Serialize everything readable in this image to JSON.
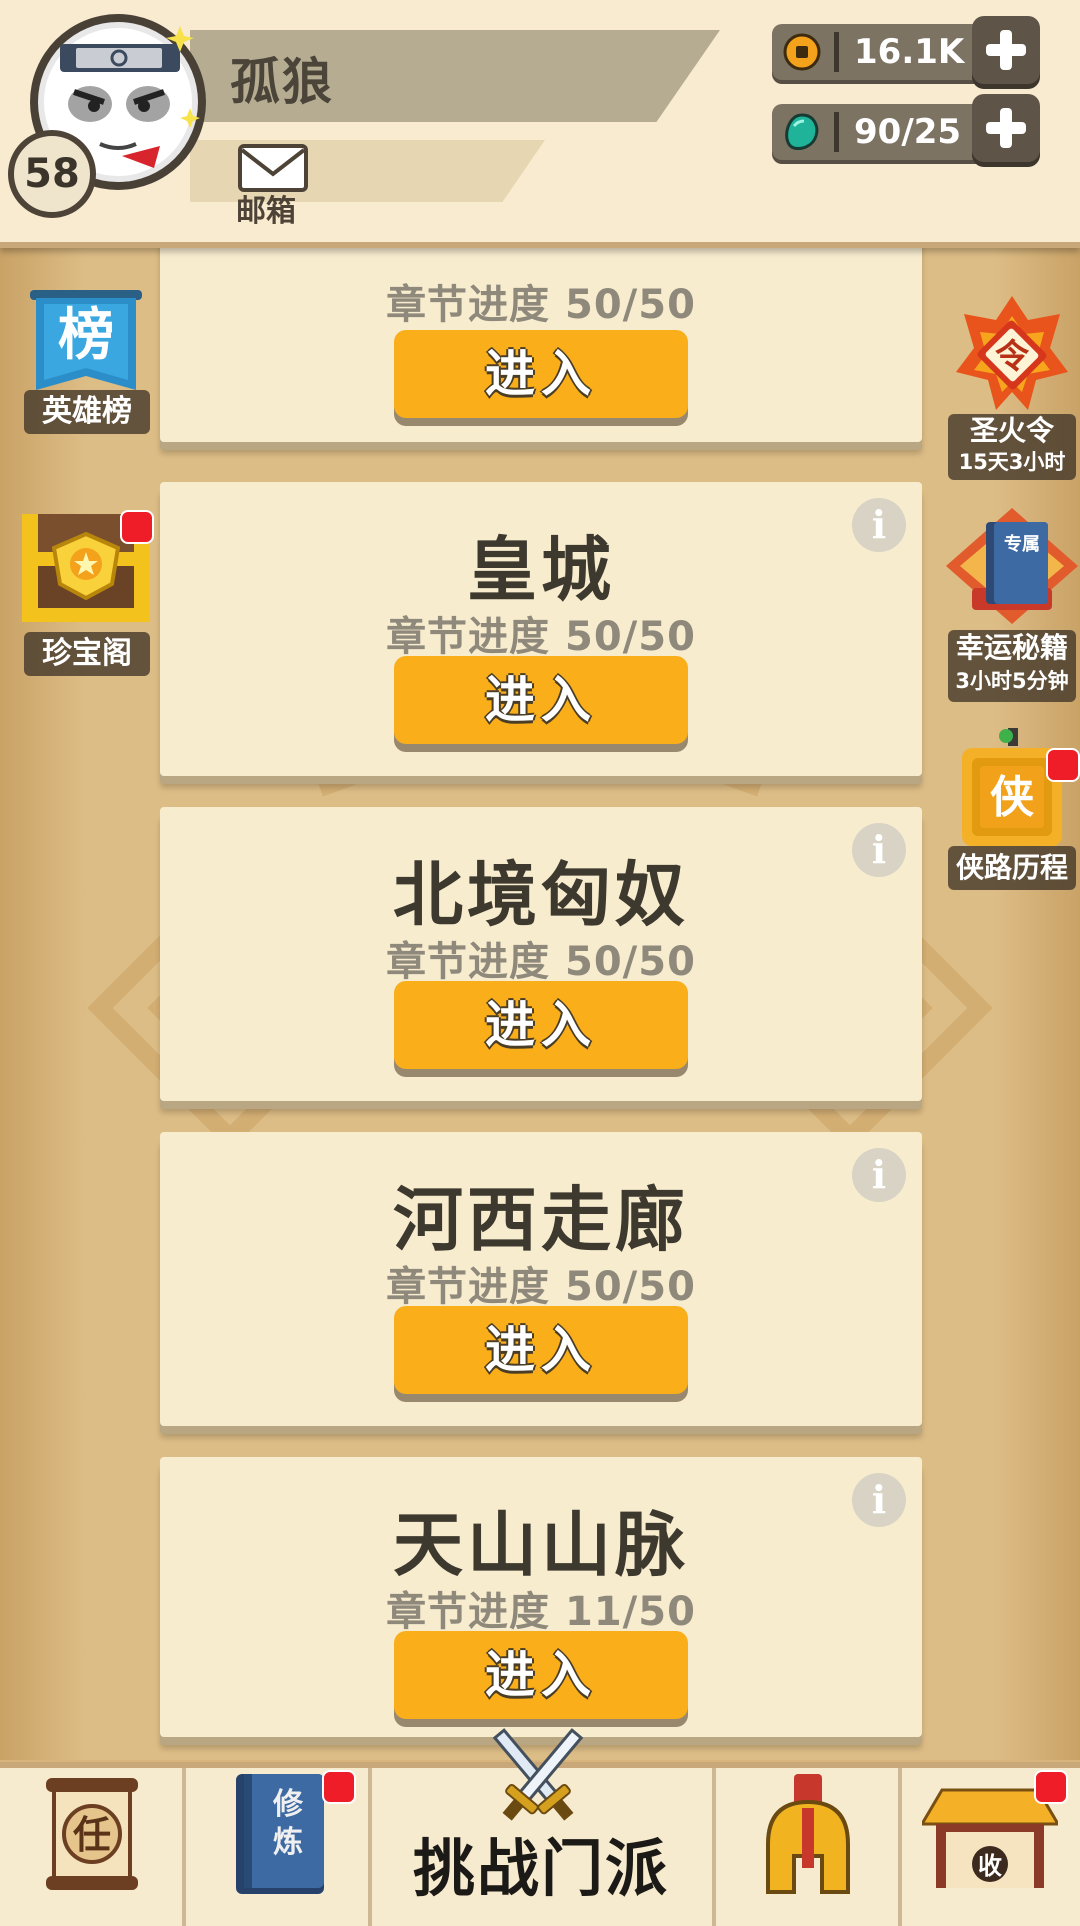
{
  "header": {
    "player_name": "孤狼",
    "level": "58",
    "mail_label": "邮箱",
    "currencies": [
      {
        "icon": "gold-coin-icon",
        "value": "16.1K"
      },
      {
        "icon": "green-gem-icon",
        "value": "90/25"
      }
    ]
  },
  "left_menu": [
    {
      "label": "英雄榜",
      "icon": "ranking-banner-icon",
      "badge": false
    },
    {
      "label": "珍宝阁",
      "icon": "treasure-chest-icon",
      "badge": true
    }
  ],
  "right_menu": [
    {
      "label": "圣火令",
      "sublabel": "15天3小时",
      "icon": "flame-token-icon",
      "badge": false
    },
    {
      "label": "幸运秘籍",
      "sublabel": "3小时5分钟",
      "icon": "secret-book-icon",
      "icon_text": "专属",
      "badge": false
    },
    {
      "label": "侠路历程",
      "icon": "hero-road-icon",
      "icon_text": "侠",
      "badge": true
    }
  ],
  "stages": [
    {
      "title": "",
      "progress": "章节进度 50/50",
      "enter_label": "进入"
    },
    {
      "title": "皇城",
      "progress": "章节进度 50/50",
      "enter_label": "进入"
    },
    {
      "title": "北境匈奴",
      "progress": "章节进度 50/50",
      "enter_label": "进入"
    },
    {
      "title": "河西走廊",
      "progress": "章节进度 50/50",
      "enter_label": "进入"
    },
    {
      "title": "天山山脉",
      "progress": "章节进度 11/50",
      "enter_label": "进入"
    }
  ],
  "bottom_nav": {
    "items": [
      {
        "icon": "task-scroll-icon",
        "icon_text": "任",
        "badge": false
      },
      {
        "icon": "training-book-icon",
        "icon_text": "修炼",
        "badge": true
      },
      {
        "icon": "crossed-swords-icon",
        "label": "挑战门派",
        "badge": false
      },
      {
        "icon": "helmet-icon",
        "badge": false
      },
      {
        "icon": "collect-building-icon",
        "icon_text": "收",
        "badge": true
      }
    ]
  },
  "colors": {
    "enter_button": "#f9ae1a",
    "card": "#f8eccf",
    "board": "#ddbd86",
    "badge": "#ef1d28"
  }
}
